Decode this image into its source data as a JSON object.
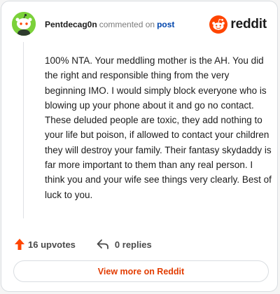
{
  "header": {
    "username": "Pentdecag0n",
    "action": "commented on",
    "post_link": "post"
  },
  "brand": {
    "name": "reddit",
    "icon": "reddit-alien-icon",
    "accent": "#ff4500"
  },
  "comment": {
    "text": "100% NTA. Your meddling mother is the AH. You did the right and responsible thing from the very beginning IMO. I would simply block everyone who is blowing up your phone about it and go no contact. These deluded people are toxic, they add nothing to your life but poison, if allowed to contact your children they will destroy your family. Their fantasy skydaddy is far more important to them than any real person. I think you and your wife see things very clearly. Best of luck to you."
  },
  "actions": {
    "upvotes": "16 upvotes",
    "upvote_icon": "upvote-arrow-icon",
    "upvote_color": "#ff4500",
    "replies": "0 replies",
    "reply_icon": "reply-arrow-icon"
  },
  "footer": {
    "view_more": "View more on Reddit",
    "link_color": "#e23c00"
  }
}
